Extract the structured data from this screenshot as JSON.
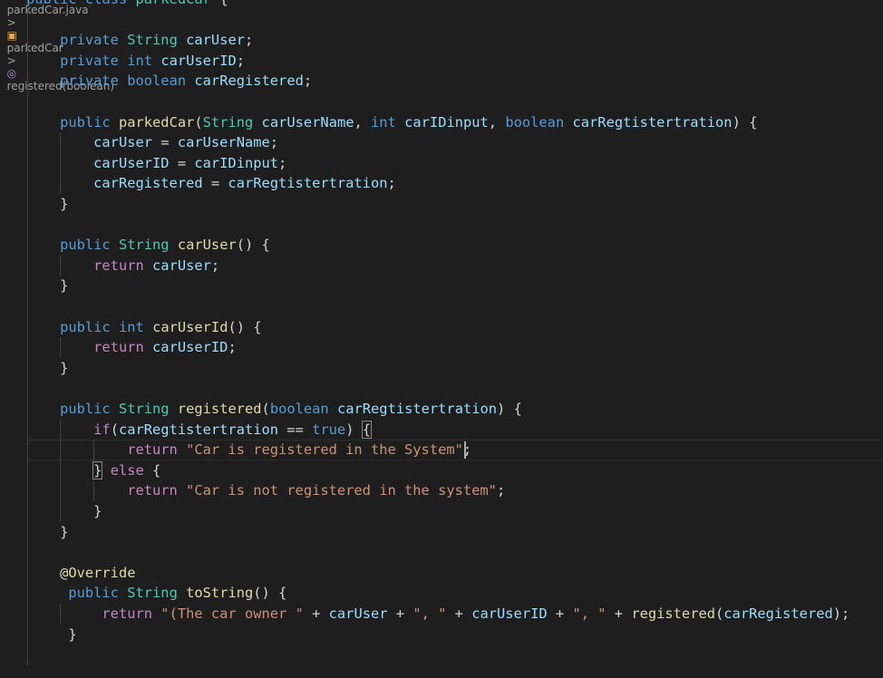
{
  "breadcrumb": {
    "file": "parkedCar.java",
    "class": "parkedCar",
    "method": "registered(boolean)",
    "separator": ">"
  },
  "colors": {
    "background": "#1e1e1e",
    "keyword": "#569cd6",
    "control": "#c586c0",
    "type": "#4ec9b0",
    "function": "#dcdcaa",
    "variable": "#9cdcfe",
    "string": "#ce9178",
    "text": "#d4d4d4"
  },
  "code": [
    [
      [
        "kw",
        "public"
      ],
      [
        "pun",
        " "
      ],
      [
        "kw",
        "class"
      ],
      [
        "pun",
        " "
      ],
      [
        "typ",
        "parkedCar"
      ],
      [
        "pun",
        " {"
      ]
    ],
    [],
    [
      [
        "pun",
        "    "
      ],
      [
        "kw",
        "private"
      ],
      [
        "pun",
        " "
      ],
      [
        "typ",
        "String"
      ],
      [
        "pun",
        " "
      ],
      [
        "var",
        "carUser"
      ],
      [
        "pun",
        ";"
      ]
    ],
    [
      [
        "pun",
        "    "
      ],
      [
        "kw",
        "private"
      ],
      [
        "pun",
        " "
      ],
      [
        "kw",
        "int"
      ],
      [
        "pun",
        " "
      ],
      [
        "var",
        "carUserID"
      ],
      [
        "pun",
        ";"
      ]
    ],
    [
      [
        "pun",
        "    "
      ],
      [
        "kw",
        "private"
      ],
      [
        "pun",
        " "
      ],
      [
        "kw",
        "boolean"
      ],
      [
        "pun",
        " "
      ],
      [
        "var",
        "carRegistered"
      ],
      [
        "pun",
        ";"
      ]
    ],
    [],
    [
      [
        "pun",
        "    "
      ],
      [
        "kw",
        "public"
      ],
      [
        "pun",
        " "
      ],
      [
        "fn",
        "parkedCar"
      ],
      [
        "pun",
        "("
      ],
      [
        "typ",
        "String"
      ],
      [
        "pun",
        " "
      ],
      [
        "var",
        "carUserName"
      ],
      [
        "pun",
        ", "
      ],
      [
        "kw",
        "int"
      ],
      [
        "pun",
        " "
      ],
      [
        "var",
        "carIDinput"
      ],
      [
        "pun",
        ", "
      ],
      [
        "kw",
        "boolean"
      ],
      [
        "pun",
        " "
      ],
      [
        "var",
        "carRegtistertration"
      ],
      [
        "pun",
        ") {"
      ]
    ],
    [
      [
        "pun",
        "        "
      ],
      [
        "var",
        "carUser"
      ],
      [
        "pun",
        " = "
      ],
      [
        "var",
        "carUserName"
      ],
      [
        "pun",
        ";"
      ]
    ],
    [
      [
        "pun",
        "        "
      ],
      [
        "var",
        "carUserID"
      ],
      [
        "pun",
        " = "
      ],
      [
        "var",
        "carIDinput"
      ],
      [
        "pun",
        ";"
      ]
    ],
    [
      [
        "pun",
        "        "
      ],
      [
        "var",
        "carRegistered"
      ],
      [
        "pun",
        " = "
      ],
      [
        "var",
        "carRegtistertration"
      ],
      [
        "pun",
        ";"
      ]
    ],
    [
      [
        "pun",
        "    }"
      ]
    ],
    [],
    [
      [
        "pun",
        "    "
      ],
      [
        "kw",
        "public"
      ],
      [
        "pun",
        " "
      ],
      [
        "typ",
        "String"
      ],
      [
        "pun",
        " "
      ],
      [
        "fn",
        "carUser"
      ],
      [
        "pun",
        "() {"
      ]
    ],
    [
      [
        "pun",
        "        "
      ],
      [
        "ctl",
        "return"
      ],
      [
        "pun",
        " "
      ],
      [
        "var",
        "carUser"
      ],
      [
        "pun",
        ";"
      ]
    ],
    [
      [
        "pun",
        "    }"
      ]
    ],
    [],
    [
      [
        "pun",
        "    "
      ],
      [
        "kw",
        "public"
      ],
      [
        "pun",
        " "
      ],
      [
        "kw",
        "int"
      ],
      [
        "pun",
        " "
      ],
      [
        "fn",
        "carUserId"
      ],
      [
        "pun",
        "() {"
      ]
    ],
    [
      [
        "pun",
        "        "
      ],
      [
        "ctl",
        "return"
      ],
      [
        "pun",
        " "
      ],
      [
        "var",
        "carUserID"
      ],
      [
        "pun",
        ";"
      ]
    ],
    [
      [
        "pun",
        "    }"
      ]
    ],
    [],
    [
      [
        "pun",
        "    "
      ],
      [
        "kw",
        "public"
      ],
      [
        "pun",
        " "
      ],
      [
        "typ",
        "String"
      ],
      [
        "pun",
        " "
      ],
      [
        "fn",
        "registered"
      ],
      [
        "pun",
        "("
      ],
      [
        "kw",
        "boolean"
      ],
      [
        "pun",
        " "
      ],
      [
        "var",
        "carRegtistertration"
      ],
      [
        "pun",
        ") {"
      ]
    ],
    [
      [
        "pun",
        "        "
      ],
      [
        "ctl",
        "if"
      ],
      [
        "pun",
        "("
      ],
      [
        "var",
        "carRegtistertration"
      ],
      [
        "pun",
        " == "
      ],
      [
        "kw",
        "true"
      ],
      [
        "pun",
        ") "
      ],
      [
        "pun*",
        "{"
      ]
    ],
    [
      [
        "pun",
        "            "
      ],
      [
        "ctl",
        "return"
      ],
      [
        "pun",
        " "
      ],
      [
        "str",
        "\"Car is registered in the System\""
      ],
      [
        "pun",
        ";"
      ]
    ],
    [
      [
        "pun",
        "        "
      ],
      [
        "pun*",
        "}"
      ],
      [
        "pun",
        " "
      ],
      [
        "ctl",
        "else"
      ],
      [
        "pun",
        " {"
      ]
    ],
    [
      [
        "pun",
        "            "
      ],
      [
        "ctl",
        "return"
      ],
      [
        "pun",
        " "
      ],
      [
        "str",
        "\"Car is not registered in the system\""
      ],
      [
        "pun",
        ";"
      ]
    ],
    [
      [
        "pun",
        "        }"
      ]
    ],
    [
      [
        "pun",
        "    }"
      ]
    ],
    [],
    [
      [
        "pun",
        "    "
      ],
      [
        "ann",
        "@Override"
      ]
    ],
    [
      [
        "pun",
        "     "
      ],
      [
        "kw",
        "public"
      ],
      [
        "pun",
        " "
      ],
      [
        "typ",
        "String"
      ],
      [
        "pun",
        " "
      ],
      [
        "fn",
        "toString"
      ],
      [
        "pun",
        "() {"
      ]
    ],
    [
      [
        "pun",
        "         "
      ],
      [
        "ctl",
        "return"
      ],
      [
        "pun",
        " "
      ],
      [
        "str",
        "\"(The car owner \""
      ],
      [
        "pun",
        " + "
      ],
      [
        "var",
        "carUser"
      ],
      [
        "pun",
        " + "
      ],
      [
        "str",
        "\", \""
      ],
      [
        "pun",
        " + "
      ],
      [
        "var",
        "carUserID"
      ],
      [
        "pun",
        " + "
      ],
      [
        "str",
        "\", \""
      ],
      [
        "pun",
        " + "
      ],
      [
        "fn",
        "registered"
      ],
      [
        "pun",
        "("
      ],
      [
        "var",
        "carRegistered"
      ],
      [
        "pun",
        ");"
      ]
    ],
    [
      [
        "pun",
        "     }"
      ]
    ]
  ]
}
